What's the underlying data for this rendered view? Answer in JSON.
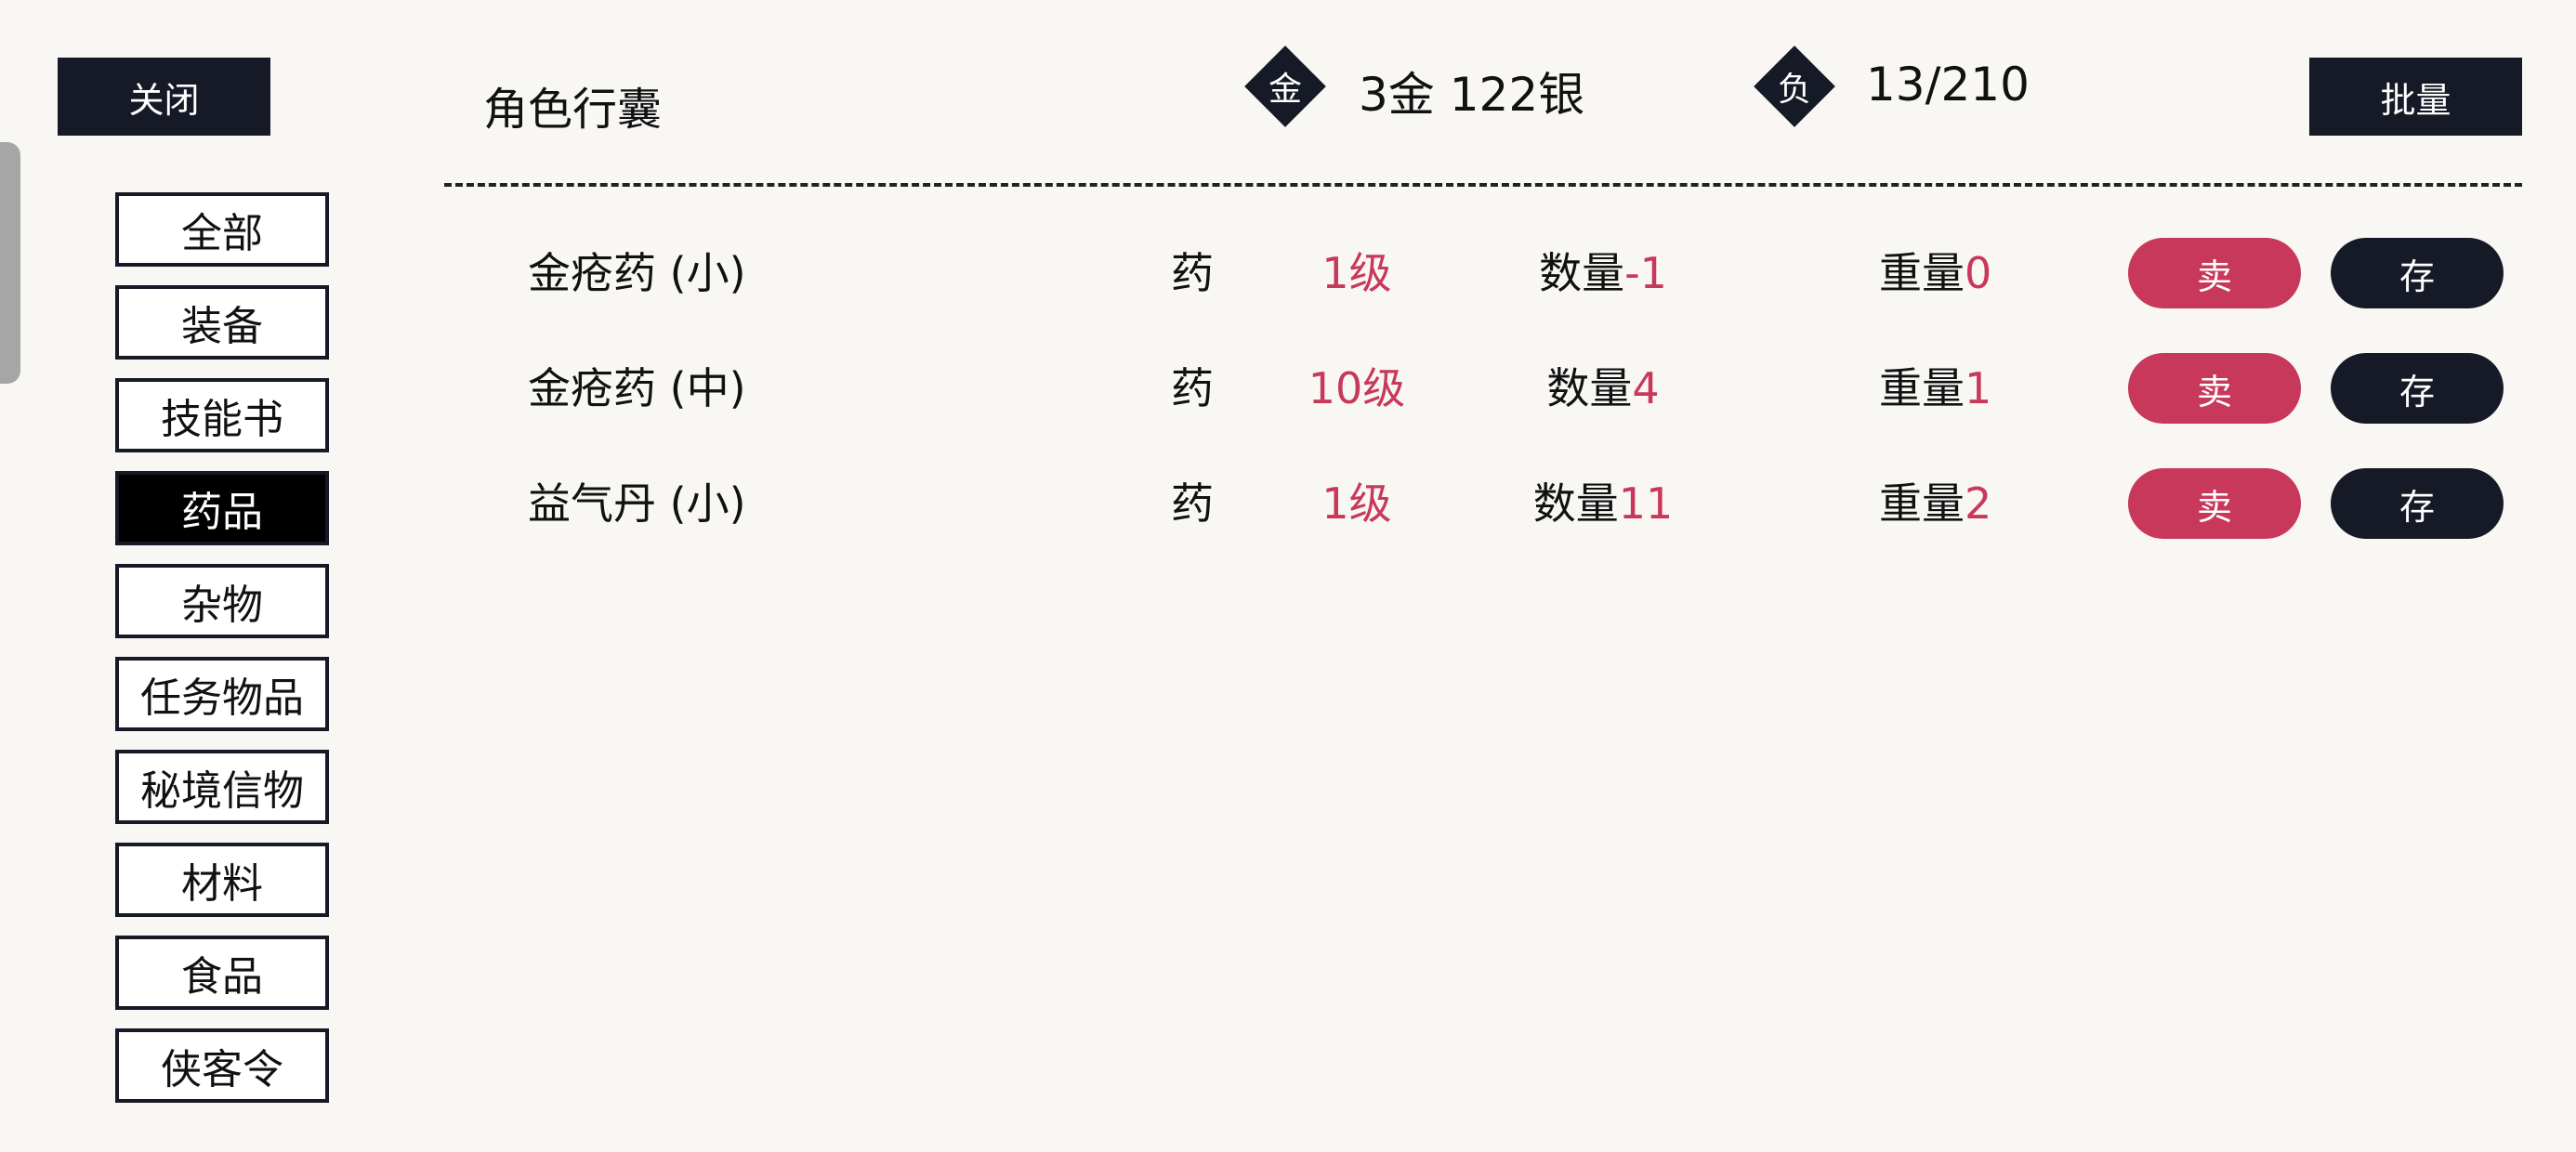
{
  "close_label": "关闭",
  "batch_label": "批量",
  "title": "角色行囊",
  "money": {
    "icon_label": "金",
    "value": "3金 122银"
  },
  "load": {
    "icon_label": "负",
    "value": "13/210"
  },
  "categories": [
    {
      "label": "全部",
      "active": false
    },
    {
      "label": "装备",
      "active": false
    },
    {
      "label": "技能书",
      "active": false
    },
    {
      "label": "药品",
      "active": true
    },
    {
      "label": "杂物",
      "active": false
    },
    {
      "label": "任务物品",
      "active": false
    },
    {
      "label": "秘境信物",
      "active": false
    },
    {
      "label": "材料",
      "active": false
    },
    {
      "label": "食品",
      "active": false
    },
    {
      "label": "侠客令",
      "active": false
    }
  ],
  "items": [
    {
      "name": "金疮药 (小)",
      "type": "药",
      "level": "1级",
      "qty_label": "数量",
      "qty": "-1",
      "weight_label": "重量",
      "weight": "0",
      "sell": "卖",
      "store": "存"
    },
    {
      "name": "金疮药 (中)",
      "type": "药",
      "level": "10级",
      "qty_label": "数量",
      "qty": "4",
      "weight_label": "重量",
      "weight": "1",
      "sell": "卖",
      "store": "存"
    },
    {
      "name": "益气丹 (小)",
      "type": "药",
      "level": "1级",
      "qty_label": "数量",
      "qty": "11",
      "weight_label": "重量",
      "weight": "2",
      "sell": "卖",
      "store": "存"
    }
  ],
  "colors": {
    "dark": "#161a26",
    "accent_red": "#c8385a",
    "background": "#f8f7f4"
  }
}
